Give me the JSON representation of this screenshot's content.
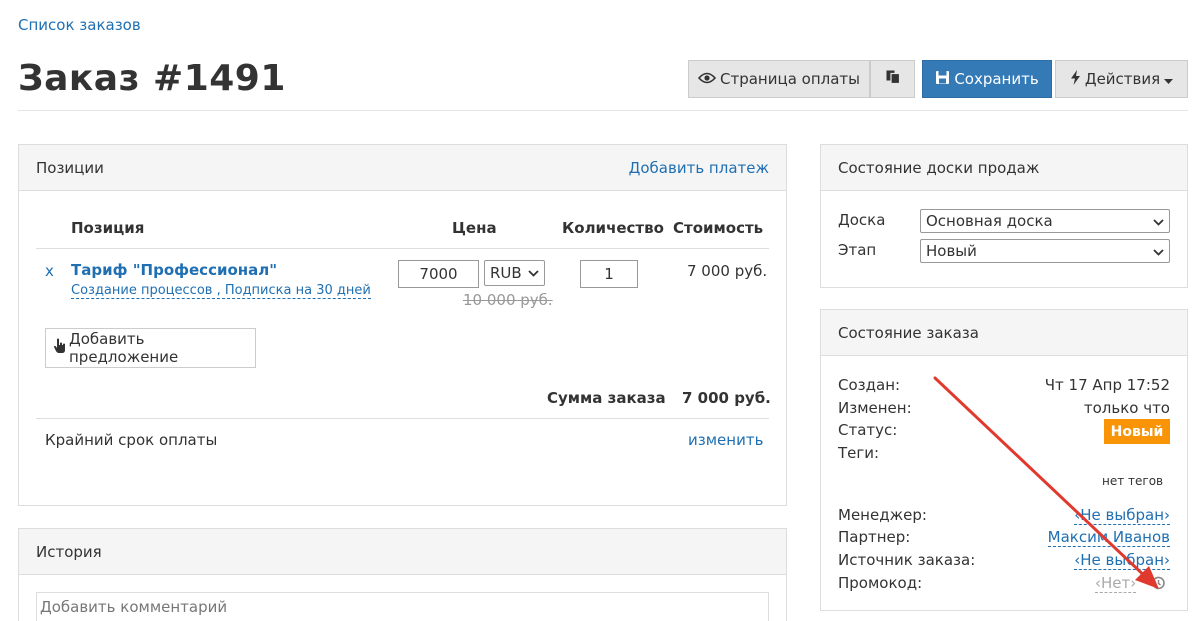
{
  "breadcrumb": "Список заказов",
  "title": "Заказ #1491",
  "toolbar": {
    "payment_page": "Страница оплаты",
    "save": "Сохранить",
    "actions": "Действия"
  },
  "positions": {
    "header": "Позиции",
    "add_payment": "Добавить платеж",
    "columns": [
      "Позиция",
      "Цена",
      "Количество",
      "Стоимость"
    ],
    "item": {
      "remove": "x",
      "name": "Тариф \"Профессионал\"",
      "subtitle": "Создание процессов , Подписка на 30 дней",
      "price": "7000",
      "currency": "RUB",
      "old_price": "10 000 руб.",
      "quantity": "1",
      "cost": "7 000 руб."
    },
    "add_offer": "Добавить предложение",
    "total_label": "Сумма заказа",
    "total_value": "7 000 руб.",
    "deadline_label": "Крайний срок оплаты",
    "deadline_action": "изменить"
  },
  "history": {
    "header": "История",
    "comment_placeholder": "Добавить комментарий"
  },
  "board": {
    "header": "Состояние доски продаж",
    "board_label": "Доска",
    "board_value": "Основная доска",
    "stage_label": "Этап",
    "stage_value": "Новый"
  },
  "order_state": {
    "header": "Состояние заказа",
    "created_label": "Создан:",
    "created_value": "Чт 17 Апр 17:52",
    "modified_label": "Изменен:",
    "modified_value": "только что",
    "status_label": "Статус:",
    "status_value": "Новый",
    "status_color": "#f89406",
    "tags_label": "Теги:",
    "tags_value": "нет тегов",
    "manager_label": "Менеджер:",
    "manager_value": "‹Не выбран›",
    "partner_label": "Партнер:",
    "partner_value": "Максим Иванов",
    "source_label": "Источник заказа:",
    "source_value": "‹Не выбран›",
    "promo_label": "Промокод:",
    "promo_value": "‹Нет›"
  },
  "colors": {
    "accent": "#337ab7",
    "link": "#1f6fb2",
    "annotation_arrow": "#e03a2f"
  }
}
